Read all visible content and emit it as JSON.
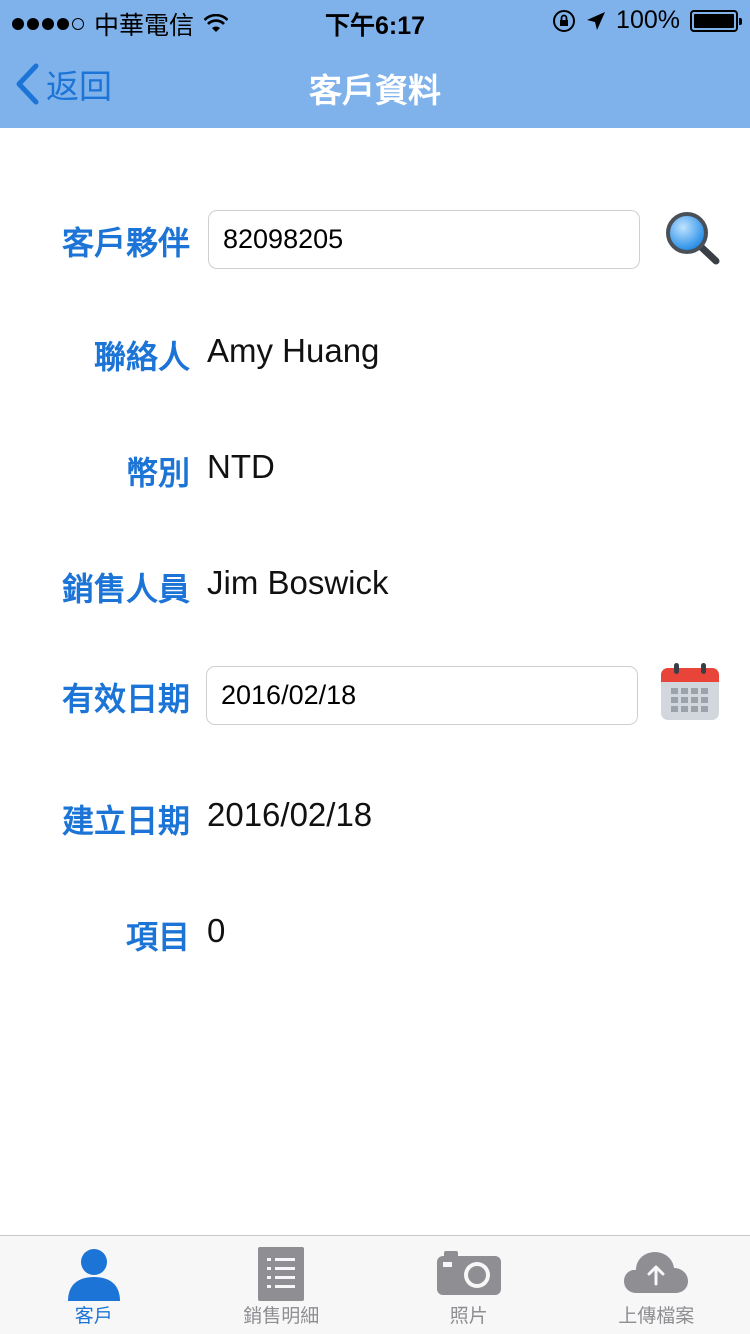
{
  "status_bar": {
    "carrier": "中華電信",
    "time": "下午6:17",
    "battery": "100%"
  },
  "nav": {
    "back_label": "返回",
    "title": "客戶資料"
  },
  "form": {
    "customer_partner_label": "客戶夥伴",
    "customer_partner_value": "82098205",
    "contact_label": "聯絡人",
    "contact_value": "Amy Huang",
    "currency_label": "幣別",
    "currency_value": "NTD",
    "salesperson_label": "銷售人員",
    "salesperson_value": "Jim Boswick",
    "valid_date_label": "有效日期",
    "valid_date_value": "2016/02/18",
    "created_date_label": "建立日期",
    "created_date_value": "2016/02/18",
    "items_label": "項目",
    "items_value": "0"
  },
  "tabs": [
    {
      "label": "客戶",
      "icon": "person-icon",
      "active": true
    },
    {
      "label": "銷售明細",
      "icon": "list-icon",
      "active": false
    },
    {
      "label": "照片",
      "icon": "camera-icon",
      "active": false
    },
    {
      "label": "上傳檔案",
      "icon": "cloud-upload-icon",
      "active": false
    }
  ],
  "colors": {
    "header": "#7fb2eb",
    "accent": "#1c74d6"
  }
}
